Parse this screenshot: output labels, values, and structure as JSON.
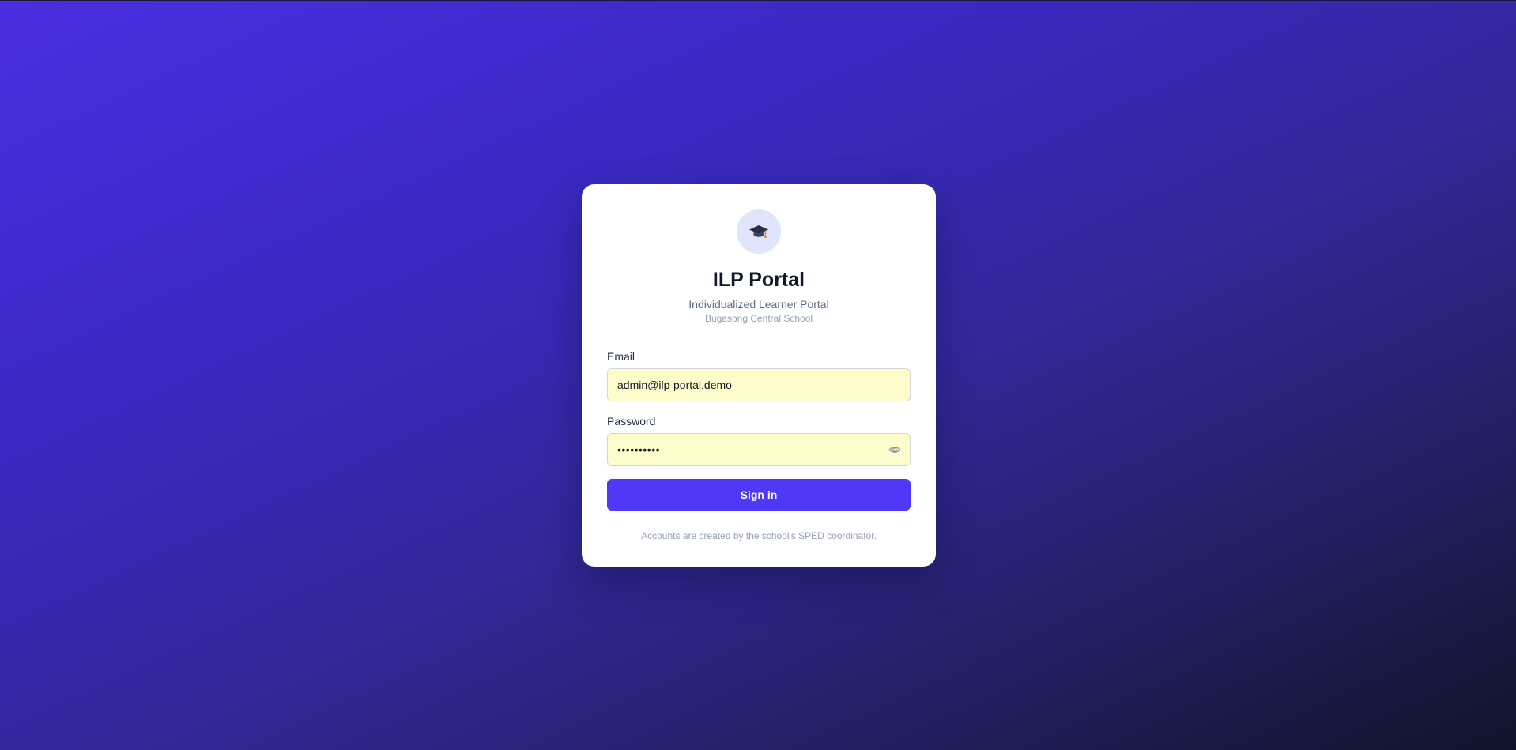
{
  "app": {
    "logo_icon": "graduation-cap-icon",
    "title": "ILP Portal",
    "subtitle": "Individualized Learner Portal",
    "school": "Bugasong Central School"
  },
  "form": {
    "email_label": "Email",
    "email_value": "admin@ilp-portal.demo",
    "password_label": "Password",
    "password_value": "••••••••••",
    "password_toggle_icon": "eye-icon",
    "signin_label": "Sign in"
  },
  "footer": {
    "note": "Accounts are created by the school's SPED coordinator."
  },
  "colors": {
    "accent": "#4f39f6",
    "input_autofill_bg": "#fefcca",
    "background_start": "#4a2fe0",
    "background_end": "#10142a"
  }
}
